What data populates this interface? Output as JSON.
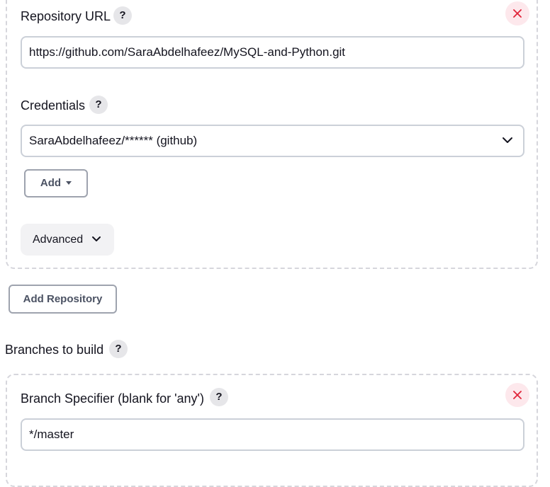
{
  "repository": {
    "url_label": "Repository URL",
    "help_glyph": "?",
    "url_value": "https://github.com/SaraAbdelhafeez/MySQL-and-Python.git",
    "credentials_label": "Credentials",
    "credentials_selected": "SaraAbdelhafeez/****** (github)",
    "add_label": "Add",
    "advanced_label": "Advanced"
  },
  "add_repository_label": "Add Repository",
  "branches": {
    "section_label": "Branches to build",
    "specifier_label": "Branch Specifier (blank for 'any')",
    "specifier_value": "*/master"
  },
  "colors": {
    "close_icon": "#e0243a",
    "close_bg": "#fde8ec",
    "help_bg": "#e6e6e9",
    "dashed_border": "#d6d6dc",
    "input_border": "#cbd0d8"
  }
}
